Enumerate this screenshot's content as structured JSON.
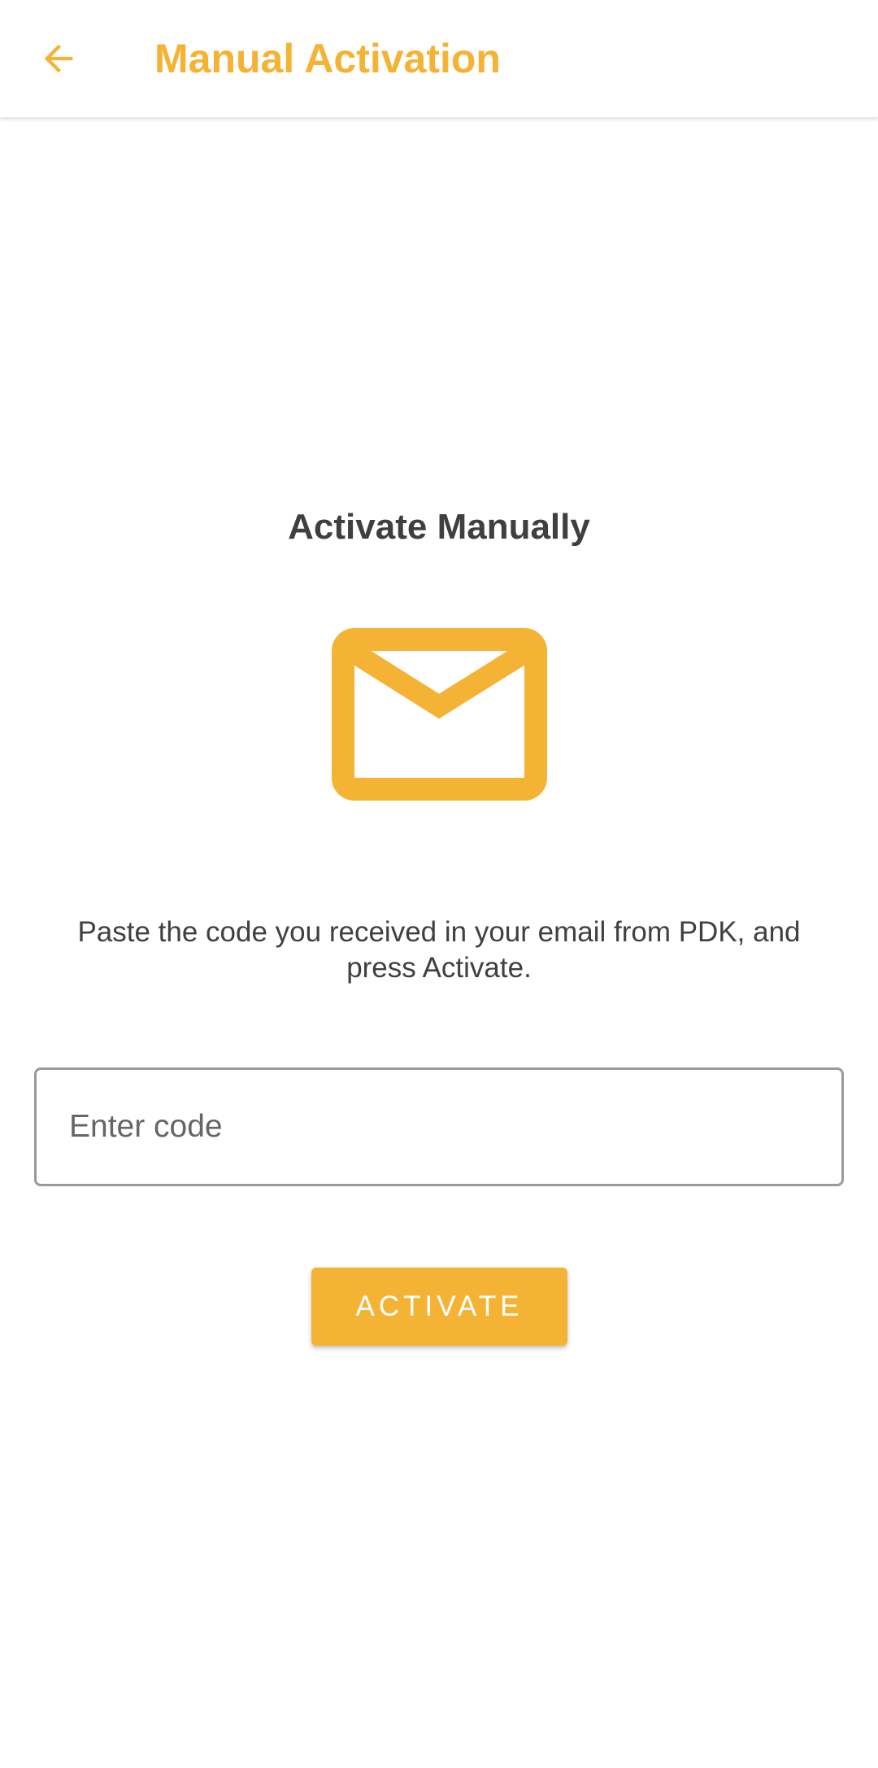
{
  "appbar": {
    "title": "Manual Activation",
    "back_icon": "arrow-left-icon"
  },
  "main": {
    "heading": "Activate Manually",
    "icon": "envelope-icon",
    "instructions": "Paste the code you received in your email from PDK, and press Activate.",
    "code_input": {
      "value": "",
      "placeholder": "Enter code"
    },
    "activate_label": "ACTIVATE"
  },
  "colors": {
    "accent": "#F5B335",
    "text": "#404040",
    "border": "#9a9a9a",
    "background": "#ffffff"
  }
}
